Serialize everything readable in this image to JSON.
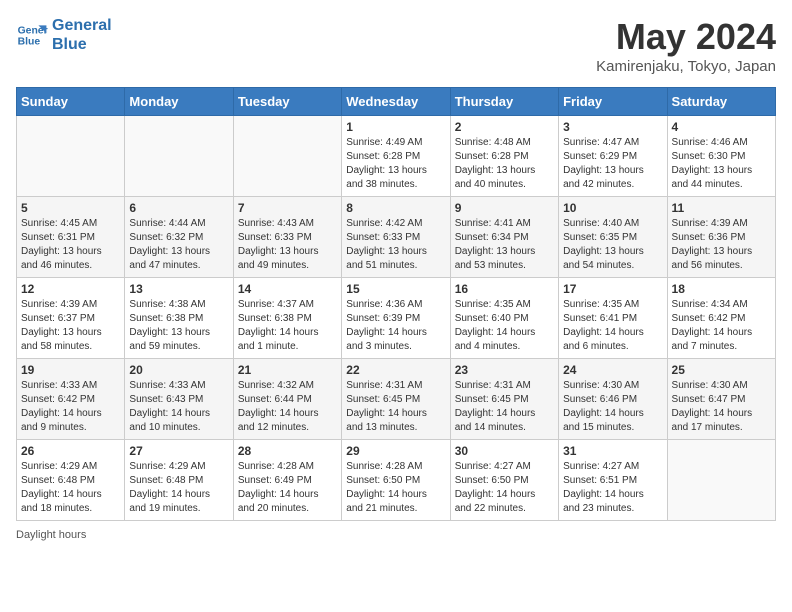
{
  "logo": {
    "line1": "General",
    "line2": "Blue"
  },
  "title": "May 2024",
  "location": "Kamirenjaku, Tokyo, Japan",
  "days_of_week": [
    "Sunday",
    "Monday",
    "Tuesday",
    "Wednesday",
    "Thursday",
    "Friday",
    "Saturday"
  ],
  "weeks": [
    [
      {
        "num": "",
        "info": ""
      },
      {
        "num": "",
        "info": ""
      },
      {
        "num": "",
        "info": ""
      },
      {
        "num": "1",
        "info": "Sunrise: 4:49 AM\nSunset: 6:28 PM\nDaylight: 13 hours and 38 minutes."
      },
      {
        "num": "2",
        "info": "Sunrise: 4:48 AM\nSunset: 6:28 PM\nDaylight: 13 hours and 40 minutes."
      },
      {
        "num": "3",
        "info": "Sunrise: 4:47 AM\nSunset: 6:29 PM\nDaylight: 13 hours and 42 minutes."
      },
      {
        "num": "4",
        "info": "Sunrise: 4:46 AM\nSunset: 6:30 PM\nDaylight: 13 hours and 44 minutes."
      }
    ],
    [
      {
        "num": "5",
        "info": "Sunrise: 4:45 AM\nSunset: 6:31 PM\nDaylight: 13 hours and 46 minutes."
      },
      {
        "num": "6",
        "info": "Sunrise: 4:44 AM\nSunset: 6:32 PM\nDaylight: 13 hours and 47 minutes."
      },
      {
        "num": "7",
        "info": "Sunrise: 4:43 AM\nSunset: 6:33 PM\nDaylight: 13 hours and 49 minutes."
      },
      {
        "num": "8",
        "info": "Sunrise: 4:42 AM\nSunset: 6:33 PM\nDaylight: 13 hours and 51 minutes."
      },
      {
        "num": "9",
        "info": "Sunrise: 4:41 AM\nSunset: 6:34 PM\nDaylight: 13 hours and 53 minutes."
      },
      {
        "num": "10",
        "info": "Sunrise: 4:40 AM\nSunset: 6:35 PM\nDaylight: 13 hours and 54 minutes."
      },
      {
        "num": "11",
        "info": "Sunrise: 4:39 AM\nSunset: 6:36 PM\nDaylight: 13 hours and 56 minutes."
      }
    ],
    [
      {
        "num": "12",
        "info": "Sunrise: 4:39 AM\nSunset: 6:37 PM\nDaylight: 13 hours and 58 minutes."
      },
      {
        "num": "13",
        "info": "Sunrise: 4:38 AM\nSunset: 6:38 PM\nDaylight: 13 hours and 59 minutes."
      },
      {
        "num": "14",
        "info": "Sunrise: 4:37 AM\nSunset: 6:38 PM\nDaylight: 14 hours and 1 minute."
      },
      {
        "num": "15",
        "info": "Sunrise: 4:36 AM\nSunset: 6:39 PM\nDaylight: 14 hours and 3 minutes."
      },
      {
        "num": "16",
        "info": "Sunrise: 4:35 AM\nSunset: 6:40 PM\nDaylight: 14 hours and 4 minutes."
      },
      {
        "num": "17",
        "info": "Sunrise: 4:35 AM\nSunset: 6:41 PM\nDaylight: 14 hours and 6 minutes."
      },
      {
        "num": "18",
        "info": "Sunrise: 4:34 AM\nSunset: 6:42 PM\nDaylight: 14 hours and 7 minutes."
      }
    ],
    [
      {
        "num": "19",
        "info": "Sunrise: 4:33 AM\nSunset: 6:42 PM\nDaylight: 14 hours and 9 minutes."
      },
      {
        "num": "20",
        "info": "Sunrise: 4:33 AM\nSunset: 6:43 PM\nDaylight: 14 hours and 10 minutes."
      },
      {
        "num": "21",
        "info": "Sunrise: 4:32 AM\nSunset: 6:44 PM\nDaylight: 14 hours and 12 minutes."
      },
      {
        "num": "22",
        "info": "Sunrise: 4:31 AM\nSunset: 6:45 PM\nDaylight: 14 hours and 13 minutes."
      },
      {
        "num": "23",
        "info": "Sunrise: 4:31 AM\nSunset: 6:45 PM\nDaylight: 14 hours and 14 minutes."
      },
      {
        "num": "24",
        "info": "Sunrise: 4:30 AM\nSunset: 6:46 PM\nDaylight: 14 hours and 15 minutes."
      },
      {
        "num": "25",
        "info": "Sunrise: 4:30 AM\nSunset: 6:47 PM\nDaylight: 14 hours and 17 minutes."
      }
    ],
    [
      {
        "num": "26",
        "info": "Sunrise: 4:29 AM\nSunset: 6:48 PM\nDaylight: 14 hours and 18 minutes."
      },
      {
        "num": "27",
        "info": "Sunrise: 4:29 AM\nSunset: 6:48 PM\nDaylight: 14 hours and 19 minutes."
      },
      {
        "num": "28",
        "info": "Sunrise: 4:28 AM\nSunset: 6:49 PM\nDaylight: 14 hours and 20 minutes."
      },
      {
        "num": "29",
        "info": "Sunrise: 4:28 AM\nSunset: 6:50 PM\nDaylight: 14 hours and 21 minutes."
      },
      {
        "num": "30",
        "info": "Sunrise: 4:27 AM\nSunset: 6:50 PM\nDaylight: 14 hours and 22 minutes."
      },
      {
        "num": "31",
        "info": "Sunrise: 4:27 AM\nSunset: 6:51 PM\nDaylight: 14 hours and 23 minutes."
      },
      {
        "num": "",
        "info": ""
      }
    ]
  ],
  "footer": {
    "daylight_label": "Daylight hours"
  }
}
